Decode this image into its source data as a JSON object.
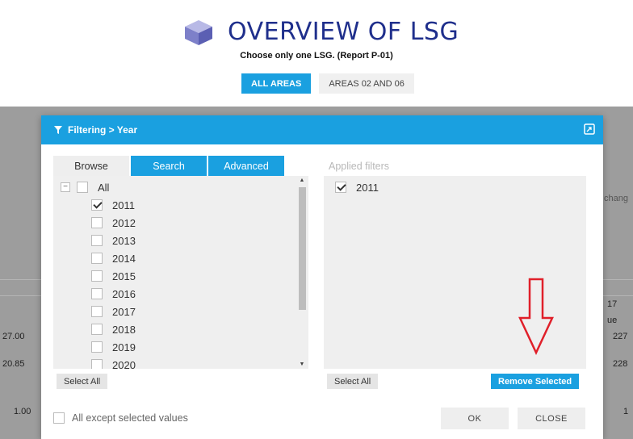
{
  "header": {
    "title": "OVERVIEW OF LSG",
    "subtitle": "Choose only one LSG. (Report P-01)",
    "area_tabs": [
      {
        "label": "ALL AREAS"
      },
      {
        "label": "AREAS 02 AND 06"
      }
    ]
  },
  "background": {
    "right_text": "chang",
    "cells": [
      "27.00",
      "20.85",
      "1.00",
      "17",
      "ue",
      "227",
      "228",
      "1"
    ]
  },
  "modal": {
    "title": "Filtering > Year",
    "tabs": [
      "Browse",
      "Search",
      "Advanced"
    ],
    "all_label": "All",
    "years": [
      {
        "label": "2011",
        "checked": true
      },
      {
        "label": "2012",
        "checked": false
      },
      {
        "label": "2013",
        "checked": false
      },
      {
        "label": "2014",
        "checked": false
      },
      {
        "label": "2015",
        "checked": false
      },
      {
        "label": "2016",
        "checked": false
      },
      {
        "label": "2017",
        "checked": false
      },
      {
        "label": "2018",
        "checked": false
      },
      {
        "label": "2019",
        "checked": false
      },
      {
        "label": "2020",
        "checked": false
      }
    ],
    "applied_title": "Applied filters",
    "applied": [
      {
        "label": "2011",
        "checked": true
      }
    ],
    "select_all_left": "Select All",
    "select_all_right": "Select All",
    "remove_selected": "Remove Selected",
    "except_label": "All except selected values",
    "ok": "OK",
    "close": "CLOSE"
  },
  "colors": {
    "accent": "#1aa0e0",
    "title": "#1f2f8c",
    "arrow": "#e0202a"
  }
}
